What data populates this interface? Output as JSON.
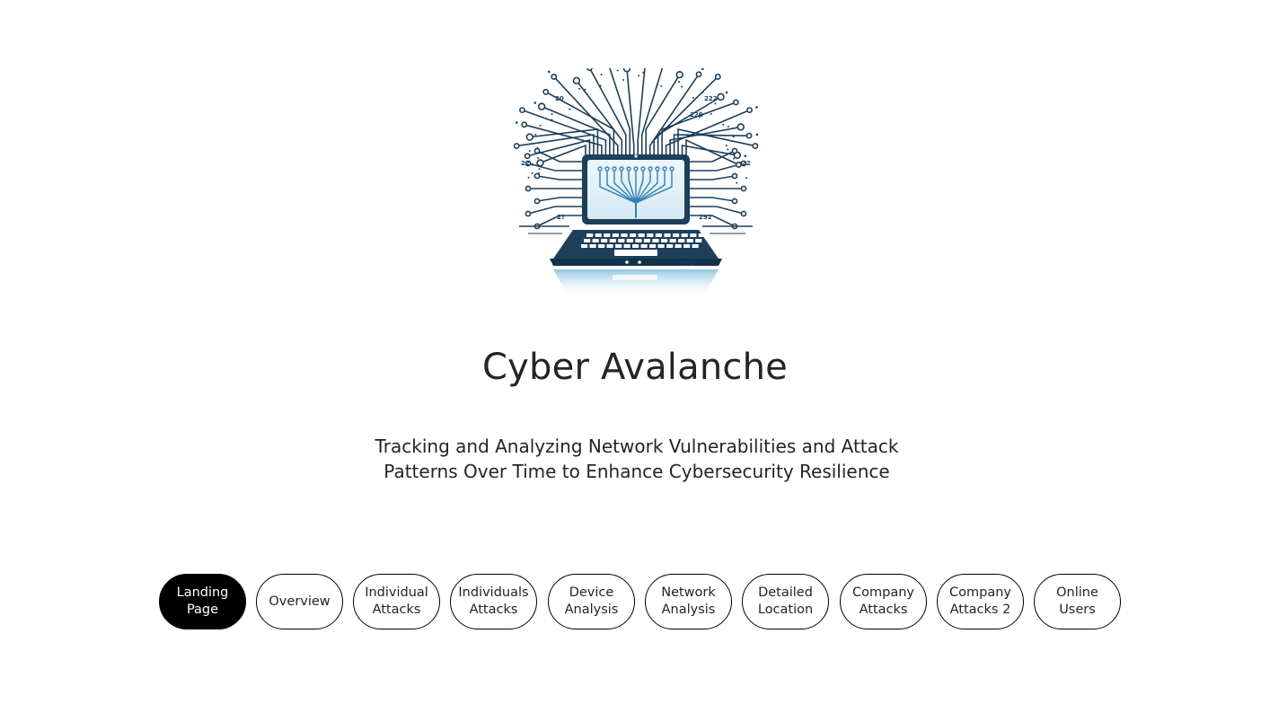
{
  "page": {
    "title": "Cyber Avalanche",
    "subtitle_line1": "Tracking and Analyzing Network Vulnerabilities and Attack",
    "subtitle_line2": "Patterns Over Time to Enhance Cybersecurity Resilience"
  },
  "logo": {
    "icon": "laptop-circuit-logo-icon",
    "labels": [
      "20",
      "222",
      "22β",
      "22",
      "2?",
      "292",
      "222",
      "22"
    ]
  },
  "nav": {
    "active_color": "#000000",
    "items": [
      {
        "line1": "Landing",
        "line2": "Page"
      },
      {
        "line1": "Overview",
        "line2": ""
      },
      {
        "line1": "Individual",
        "line2": "Attacks"
      },
      {
        "line1": "Individuals",
        "line2": "Attacks"
      },
      {
        "line1": "Device",
        "line2": "Analysis"
      },
      {
        "line1": "Network",
        "line2": "Analysis"
      },
      {
        "line1": "Detailed",
        "line2": "Location"
      },
      {
        "line1": "Company",
        "line2": "Attacks"
      },
      {
        "line1": "Company",
        "line2": "Attacks 2"
      },
      {
        "line1": "Online",
        "line2": "Users"
      }
    ]
  }
}
